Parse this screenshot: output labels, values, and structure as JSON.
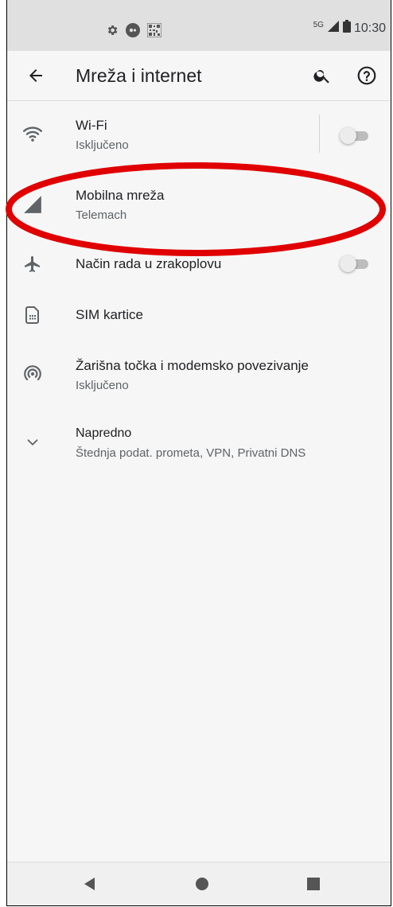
{
  "status_bar": {
    "network": "5G",
    "time": "10:30"
  },
  "app_bar": {
    "title": "Mreža i internet"
  },
  "items": [
    {
      "title": "Wi-Fi",
      "subtitle": "Isključeno",
      "icon": "wifi-icon",
      "toggle": false
    },
    {
      "title": "Mobilna mreža",
      "subtitle": "Telemach",
      "icon": "signal-icon"
    },
    {
      "title": "Način rada u zrakoplovu",
      "icon": "airplane-icon",
      "toggle": false
    },
    {
      "title": "SIM kartice",
      "icon": "sim-card-icon"
    },
    {
      "title": "Žarišna točka i modemsko povezivanje",
      "subtitle": "Isključeno",
      "icon": "hotspot-icon"
    },
    {
      "title": "Napredno",
      "subtitle": "Štednja podat. prometa, VPN, Privatni DNS",
      "icon": "chevron-down-icon"
    }
  ],
  "colors": {
    "highlight": "#e00000",
    "icon": "#5f6368",
    "text_primary": "#202124",
    "text_secondary": "#5f6368"
  }
}
